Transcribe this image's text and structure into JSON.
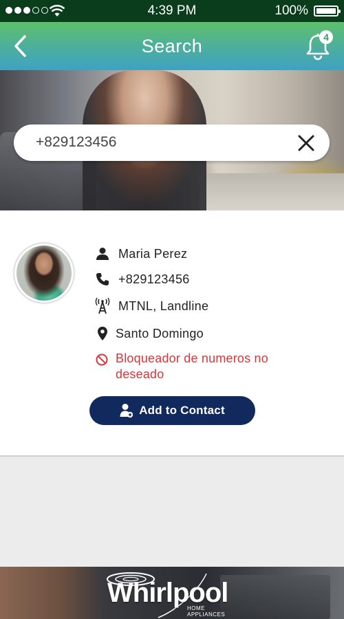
{
  "status_bar": {
    "time": "4:39 PM",
    "battery": "100%",
    "signal_bars_filled": 3,
    "signal_bars_total": 5
  },
  "nav": {
    "title": "Search",
    "notification_count": "4",
    "icons": {
      "back": "chevron-left-icon",
      "notifications": "bell-icon"
    }
  },
  "search": {
    "value": "+829123456",
    "clear_icon": "close-icon"
  },
  "contact": {
    "name": "Maria Perez",
    "phone": "+829123456",
    "carrier": "MTNL, Landline",
    "location": "Santo Domingo",
    "blocked_text": "Bloqueador de numeros no deseado",
    "add_button_label": "Add to Contact"
  },
  "banner": {
    "brand": "Whirlpool",
    "tagline": "HOME APPLIANCES"
  },
  "colors": {
    "nav_gradient_top": "#5fbf6b",
    "nav_gradient_bottom": "#3fa2c2",
    "status_bar_bg": "#0a3d1c",
    "button_bg": "#12295e",
    "alert_red": "#d9343a"
  }
}
